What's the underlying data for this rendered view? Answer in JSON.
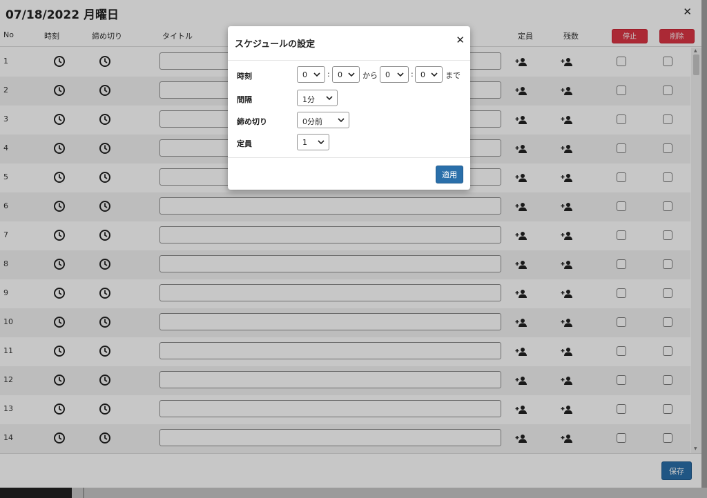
{
  "header": {
    "date_title": "07/18/2022 月曜日",
    "close_glyph": "✕"
  },
  "table": {
    "columns": {
      "no": "No",
      "time": "時刻",
      "deadline": "締め切り",
      "title": "タイトル",
      "capacity": "定員",
      "remaining": "残数"
    },
    "stop_label": "停止",
    "delete_label": "削除",
    "rows": [
      {
        "no": "1"
      },
      {
        "no": "2"
      },
      {
        "no": "3"
      },
      {
        "no": "4"
      },
      {
        "no": "5"
      },
      {
        "no": "6"
      },
      {
        "no": "7"
      },
      {
        "no": "8"
      },
      {
        "no": "9"
      },
      {
        "no": "10"
      },
      {
        "no": "11"
      },
      {
        "no": "12"
      },
      {
        "no": "13"
      },
      {
        "no": "14"
      }
    ]
  },
  "footer": {
    "save_label": "保存"
  },
  "modal": {
    "title": "スケジュールの設定",
    "close_glyph": "✕",
    "time_label": "時刻",
    "from_hour": "0",
    "from_minute": "0",
    "from_text": "から",
    "to_hour": "0",
    "to_minute": "0",
    "to_text": "まで",
    "colon": ":",
    "interval_label": "間隔",
    "interval_value": "1分",
    "deadline_label": "締め切り",
    "deadline_value": "0分前",
    "capacity_label": "定員",
    "capacity_value": "1",
    "apply_label": "適用"
  },
  "colors": {
    "primary": "#2a6faa",
    "danger": "#dc3545"
  },
  "icons": {
    "clock": "clock-icon",
    "person_add": "user-plus-icon",
    "close": "close-icon",
    "dropdown": "chevron-down-icon"
  }
}
